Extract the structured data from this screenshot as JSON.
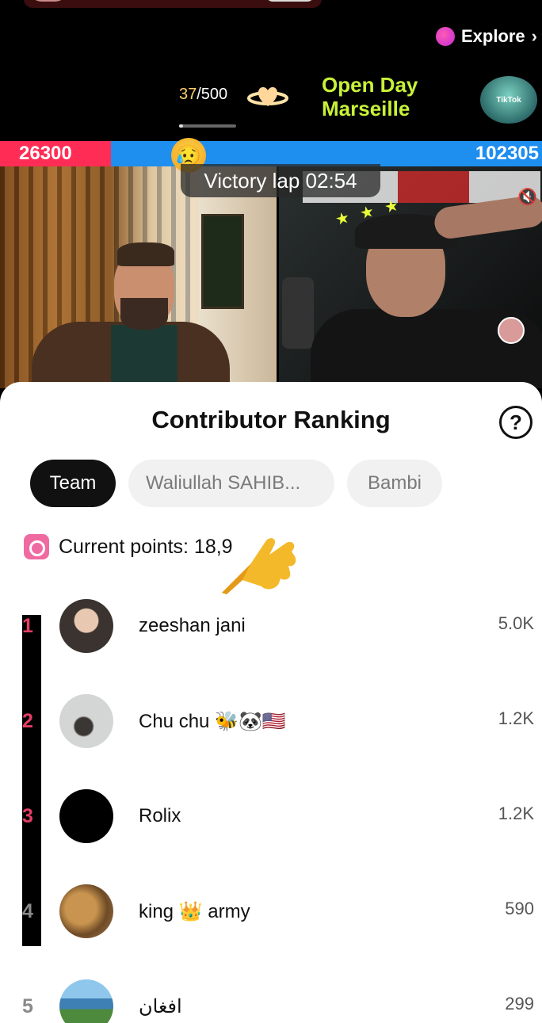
{
  "header": {
    "explore_label": "Explore",
    "explore_chevron": "›",
    "goal_current": "37",
    "goal_total": "/500",
    "goal_progress_fraction": 0.074,
    "event_title_line1": "Open Day",
    "event_title_line2": "Marseille",
    "event_badge_text": "TikTok"
  },
  "battle": {
    "left_score": "26300",
    "right_score": "102305",
    "left_color": "#ff2d55",
    "right_color": "#1e8eef",
    "left_fraction": 0.204,
    "status_emoji": "😥",
    "victory_label": "Victory lap 02:54",
    "mute_icon": "🔇"
  },
  "sheet": {
    "title": "Contributor Ranking",
    "help_label": "?",
    "tabs": [
      {
        "label": "Team",
        "active": true
      },
      {
        "label": "Waliullah SAHIB...",
        "active": false
      },
      {
        "label": "Bambi",
        "active": false
      }
    ],
    "points_label": "Current points: 18,9"
  },
  "ranking": [
    {
      "rank": "1",
      "name": "zeeshan jani",
      "score": "5.0K",
      "avatar_color": "#3a3330"
    },
    {
      "rank": "2",
      "name": "Chu chu 🐝🐼🇺🇸",
      "score": "1.2K",
      "avatar_color": "#cfd0d0"
    },
    {
      "rank": "3",
      "name": "Rolix",
      "score": "1.2K",
      "avatar_color": "#000000"
    },
    {
      "rank": "4",
      "name": "king 👑 army",
      "score": "590",
      "avatar_color": "#a87a4a"
    },
    {
      "rank": "5",
      "name": "افغان",
      "score": "299",
      "avatar_color": "#3e7fb4"
    }
  ],
  "colors": {
    "accent_rank": "#e63d64",
    "event_title": "#c8f238"
  }
}
